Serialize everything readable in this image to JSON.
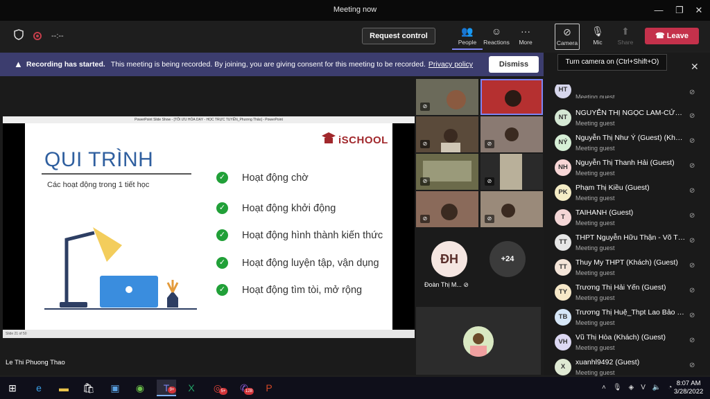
{
  "window": {
    "title": "Meeting now"
  },
  "toolbar": {
    "timer": "--:--",
    "request_control": "Request control",
    "people": "People",
    "reactions": "Reactions",
    "more": "More",
    "camera": "Camera",
    "mic": "Mic",
    "share": "Share",
    "leave": "Leave"
  },
  "banner": {
    "bold": "Recording has started.",
    "message": "This meeting is being recorded. By joining, you are giving consent for this meeting to be recorded.",
    "link": "Privacy policy",
    "dismiss": "Dismiss"
  },
  "tooltip": "Turn camera on (Ctrl+Shift+O)",
  "slide": {
    "window_title": "PowerPoint Slide Show - [TỐI ƯU HÓA DẠY - HỌC TRỰC TUYẾN_Phương Thảo] - PowerPoint",
    "title": "QUI TRÌNH",
    "subtitle": "Các hoạt động trong 1 tiết học",
    "logo": "iSCHOOL",
    "steps": [
      "Hoạt động chờ",
      "Hoạt động khởi động",
      "Hoạt động hình thành kiến thức",
      "Hoạt động luyện tập, vận dụng",
      "Hoạt động tìm tòi, mở rộng"
    ],
    "status": "Slide 21 of 50"
  },
  "presenter": "Le Thi Phuong Thao",
  "gallery": {
    "avatar_initials": "ĐH",
    "avatar_name": "Đoàn Thị M...",
    "more_count": "+24"
  },
  "participants": [
    {
      "initials": "NT",
      "name": "NGUYỄN THỊ NGỌC LAM-CỬA T...",
      "role": "Meeting guest",
      "color": "#d5e8d4"
    },
    {
      "initials": "NÝ",
      "name": "Nguyễn Thị Như Ý (Guest) (Khách)",
      "role": "Meeting guest",
      "color": "#d6efd6"
    },
    {
      "initials": "NH",
      "name": "Nguyễn Thị Thanh Hải (Guest)",
      "role": "Meeting guest",
      "color": "#f7d6d6"
    },
    {
      "initials": "PK",
      "name": "Phạm Thị Kiều (Guest)",
      "role": "Meeting guest",
      "color": "#f4ecc5"
    },
    {
      "initials": "T",
      "name": "TAIHANH (Guest)",
      "role": "Meeting guest",
      "color": "#f3d6d6"
    },
    {
      "initials": "TT",
      "name": "THPT Nguyễn Hữu Thận - Võ Th...",
      "role": "Meeting guest",
      "color": "#e6e6e6"
    },
    {
      "initials": "TT",
      "name": "Thuy My THPT (Khách) (Guest)",
      "role": "Meeting guest",
      "color": "#f3e4d8"
    },
    {
      "initials": "TY",
      "name": "Trương Thị Hải Yến (Guest)",
      "role": "Meeting guest",
      "color": "#f6e8c8"
    },
    {
      "initials": "TB",
      "name": "Trương Thị Huệ_Thpt Lao Bảo (G...",
      "role": "Meeting guest",
      "color": "#d6e6f7"
    },
    {
      "initials": "VH",
      "name": "Vũ Thị Hòa (Khách) (Guest)",
      "role": "Meeting guest",
      "color": "#dcd8f3"
    },
    {
      "initials": "X",
      "name": "xuanhl9492 (Guest)",
      "role": "Meeting guest",
      "color": "#dfe9d3"
    }
  ],
  "partial_row": {
    "initials": "HT",
    "role": "Meeting guest"
  },
  "taskbar": {
    "time": "8:07 AM",
    "date": "3/28/2022",
    "teams_badge": "9+",
    "chrome_badge": "5+",
    "viber_badge": "128"
  }
}
